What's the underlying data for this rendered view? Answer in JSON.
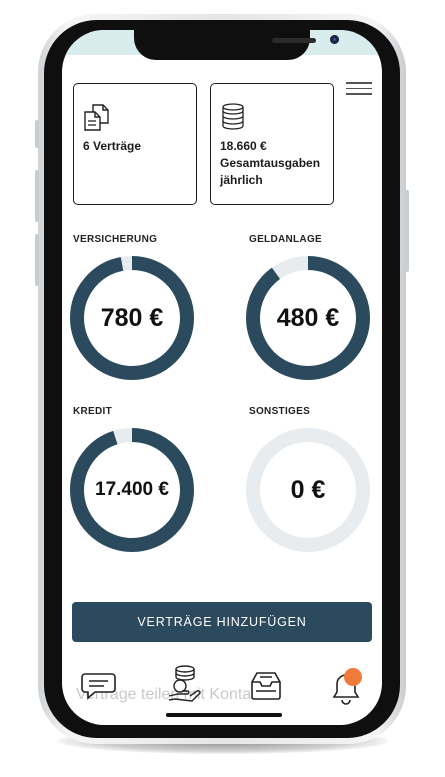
{
  "summary": {
    "contracts_label": "6 Verträge",
    "total_label": "18.660 € Gesamtausgaben jährlich"
  },
  "categories": [
    {
      "name": "VERSICHERUNG",
      "value": "780 €",
      "fill_fraction": 0.97
    },
    {
      "name": "GELDANLAGE",
      "value": "480 €",
      "fill_fraction": 0.9
    },
    {
      "name": "KREDIT",
      "value": "17.400 €",
      "fill_fraction": 0.95
    },
    {
      "name": "SONSTIGES",
      "value": "0 €",
      "fill_fraction": 0
    }
  ],
  "colors": {
    "accent": "#2b4a5e",
    "ring_track": "#e8ecee",
    "badge": "#f07a3a"
  },
  "add_button_label": "VERTRÄGE HINZUFÜGEN",
  "tabbar": {
    "overlay_text": "Verträge teilen mit Kontakten",
    "icons": [
      "chat-icon",
      "money-hand-icon",
      "inbox-icon",
      "bell-icon"
    ]
  }
}
